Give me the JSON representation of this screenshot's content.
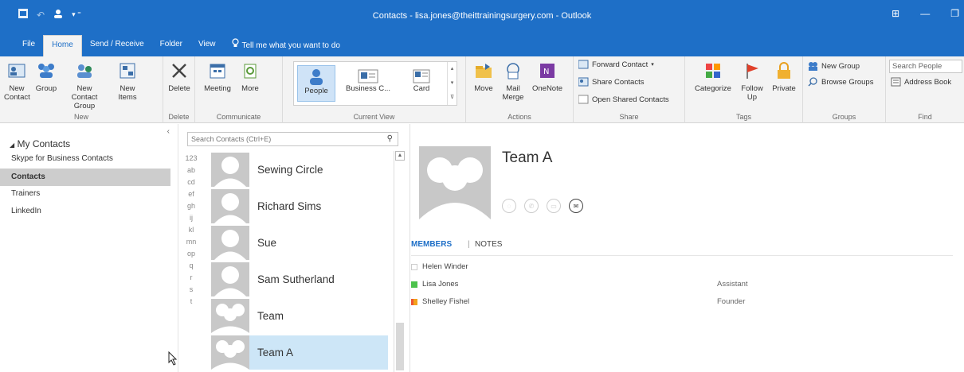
{
  "window": {
    "title": "Contacts - lisa.jones@theittrainingsurgery.com - Outlook"
  },
  "tabs": [
    {
      "label": "File"
    },
    {
      "label": "Home"
    },
    {
      "label": "Send / Receive"
    },
    {
      "label": "Folder"
    },
    {
      "label": "View"
    },
    {
      "label": "Tell me what you want to do"
    }
  ],
  "ribbon": {
    "new_group": {
      "label": "New",
      "new_contact": "New Contact",
      "group": "Group",
      "new_contact_group": "New Contact Group",
      "new_items": "New Items"
    },
    "delete_group": {
      "label": "Delete",
      "delete": "Delete"
    },
    "communicate_group": {
      "label": "Communicate",
      "meeting": "Meeting",
      "more": "More"
    },
    "view_group": {
      "label": "Current View",
      "people": "People",
      "business_card": "Business C...",
      "card": "Card"
    },
    "actions_group": {
      "label": "Actions",
      "move": "Move",
      "mail_merge": "Mail Merge",
      "onenote": "OneNote"
    },
    "share_group": {
      "label": "Share",
      "forward_contact": "Forward Contact",
      "share_contacts": "Share Contacts",
      "open_shared": "Open Shared Contacts"
    },
    "tags_group": {
      "label": "Tags",
      "categorize": "Categorize",
      "follow_up": "Follow Up",
      "private": "Private"
    },
    "groups_group": {
      "label": "Groups",
      "new_group": "New Group",
      "browse_groups": "Browse Groups"
    },
    "find_group": {
      "label": "Find",
      "search_people": "Search People",
      "address_book": "Address Book"
    }
  },
  "nav": {
    "header": "My Contacts",
    "items": [
      {
        "label": "Skype for Business Contacts"
      },
      {
        "label": "Contacts"
      },
      {
        "label": "Trainers"
      },
      {
        "label": "LinkedIn"
      }
    ]
  },
  "list": {
    "search_placeholder": "Search Contacts (Ctrl+E)",
    "alpha": [
      "123",
      "ab",
      "cd",
      "ef",
      "gh",
      "ij",
      "kl",
      "mn",
      "op",
      "q",
      "r",
      "s",
      "t"
    ],
    "contacts": [
      {
        "name": "Sewing Circle"
      },
      {
        "name": "Richard Sims"
      },
      {
        "name": "Sue"
      },
      {
        "name": "Sam Sutherland"
      },
      {
        "name": "Team"
      },
      {
        "name": "Team A"
      }
    ]
  },
  "detail": {
    "name": "Team A",
    "tab_members": "MEMBERS",
    "tab_notes": "NOTES",
    "members": [
      {
        "name": "Helen Winder",
        "role": "",
        "color": "#ffffff"
      },
      {
        "name": "Lisa Jones",
        "role": "Assistant",
        "color": "#4cc24c"
      },
      {
        "name": "Shelley Fishel",
        "role": "Founder",
        "color": "#f2a21c"
      }
    ]
  }
}
